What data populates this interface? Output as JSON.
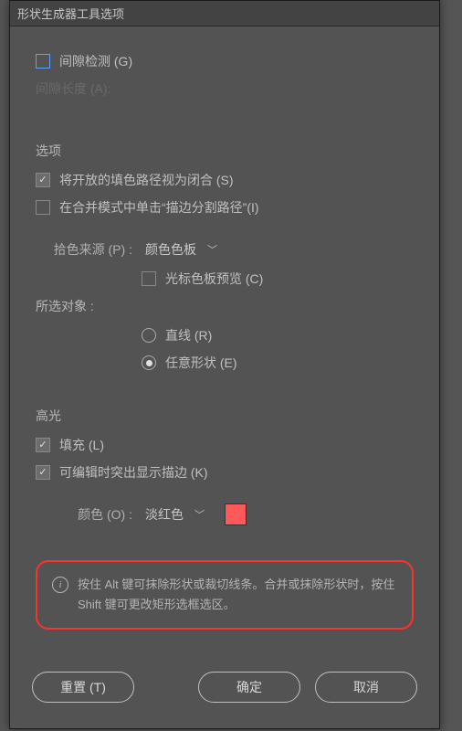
{
  "titlebar": "形状生成器工具选项",
  "gap_detection": {
    "label": "间隙检测 (G)",
    "checked": false
  },
  "gap_length_disabled": "间隙长度 (A):",
  "options": {
    "section": "选项",
    "treat_open_as_closed": {
      "label": "将开放的填色路径视为闭合 (S)",
      "checked": true
    },
    "click_stroke_split": {
      "label": "在合并模式中单击“描边分割路径”(I)",
      "checked": false
    },
    "pick_color_from": {
      "label": "拾色来源 (P) :",
      "value": "颜色色板"
    },
    "cursor_swatch_preview": {
      "label": "光标色板预览 (C)",
      "checked": false
    },
    "selection": {
      "label": "所选对象 :",
      "straight": {
        "label": "直线 (R)",
        "checked": false
      },
      "freeform": {
        "label": "任意形状 (E)",
        "checked": true
      }
    }
  },
  "highlight": {
    "section": "高光",
    "fill": {
      "label": "填充 (L)",
      "checked": true
    },
    "editable_stroke": {
      "label": "可编辑时突出显示描边 (K)",
      "checked": true
    },
    "color": {
      "label": "颜色 (O) :",
      "value": "淡红色",
      "swatch": "#ff5a5a"
    }
  },
  "info_text": "按住 Alt 键可抹除形状或裁切线条。合并或抹除形状时，按住 Shift 键可更改矩形选框选区。",
  "buttons": {
    "reset": "重置 (T)",
    "ok": "确定",
    "cancel": "取消"
  }
}
